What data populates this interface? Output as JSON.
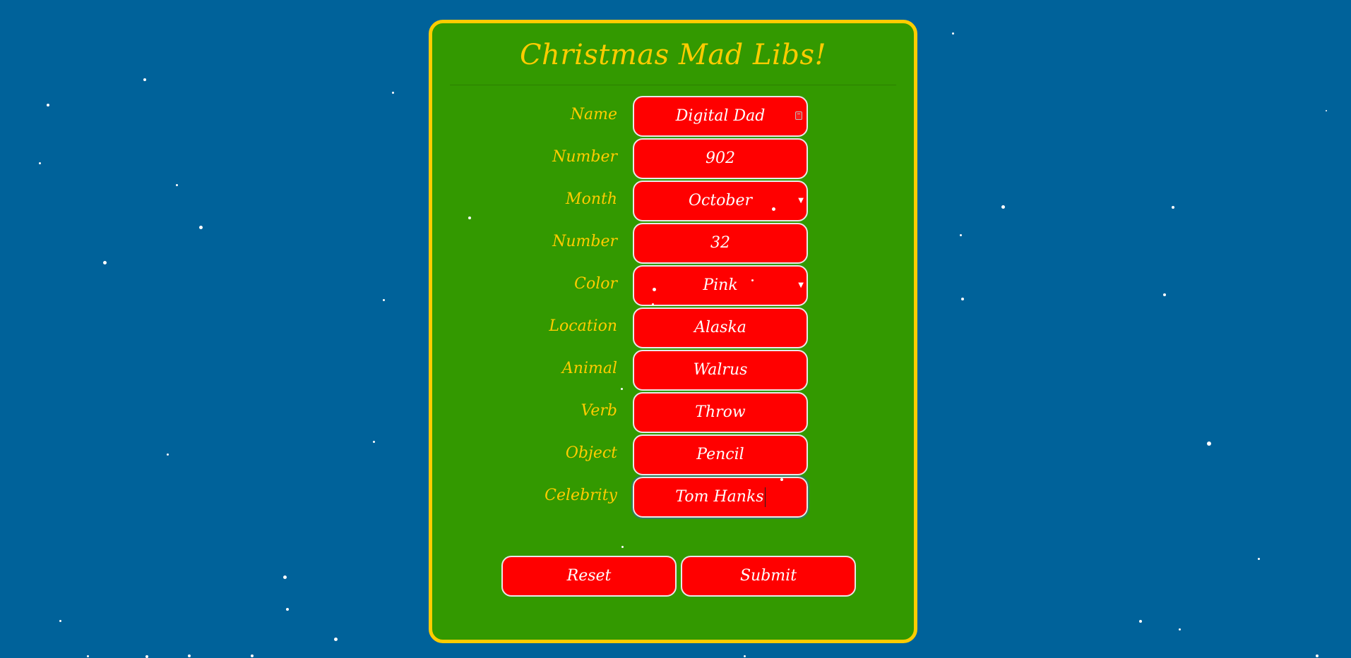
{
  "page": {
    "title": "Christmas Mad Libs!"
  },
  "colors": {
    "background": "#00629a",
    "card": "#339900",
    "border": "#ffcc00",
    "field": "#ff0000",
    "text_on_field": "#ffffff"
  },
  "form": {
    "fields": [
      {
        "label": "Name",
        "value": "Digital Dad",
        "type": "text"
      },
      {
        "label": "Number",
        "value": "902",
        "type": "number"
      },
      {
        "label": "Month",
        "value": "October",
        "type": "select"
      },
      {
        "label": "Number",
        "value": "32",
        "type": "number"
      },
      {
        "label": "Color",
        "value": "Pink",
        "type": "select"
      },
      {
        "label": "Location",
        "value": "Alaska",
        "type": "text"
      },
      {
        "label": "Animal",
        "value": "Walrus",
        "type": "text"
      },
      {
        "label": "Verb",
        "value": "Throw",
        "type": "text"
      },
      {
        "label": "Object",
        "value": "Pencil",
        "type": "text"
      },
      {
        "label": "Celebrity",
        "value": "Tom Hanks",
        "type": "text"
      }
    ],
    "reset_label": "Reset",
    "submit_label": "Submit"
  }
}
